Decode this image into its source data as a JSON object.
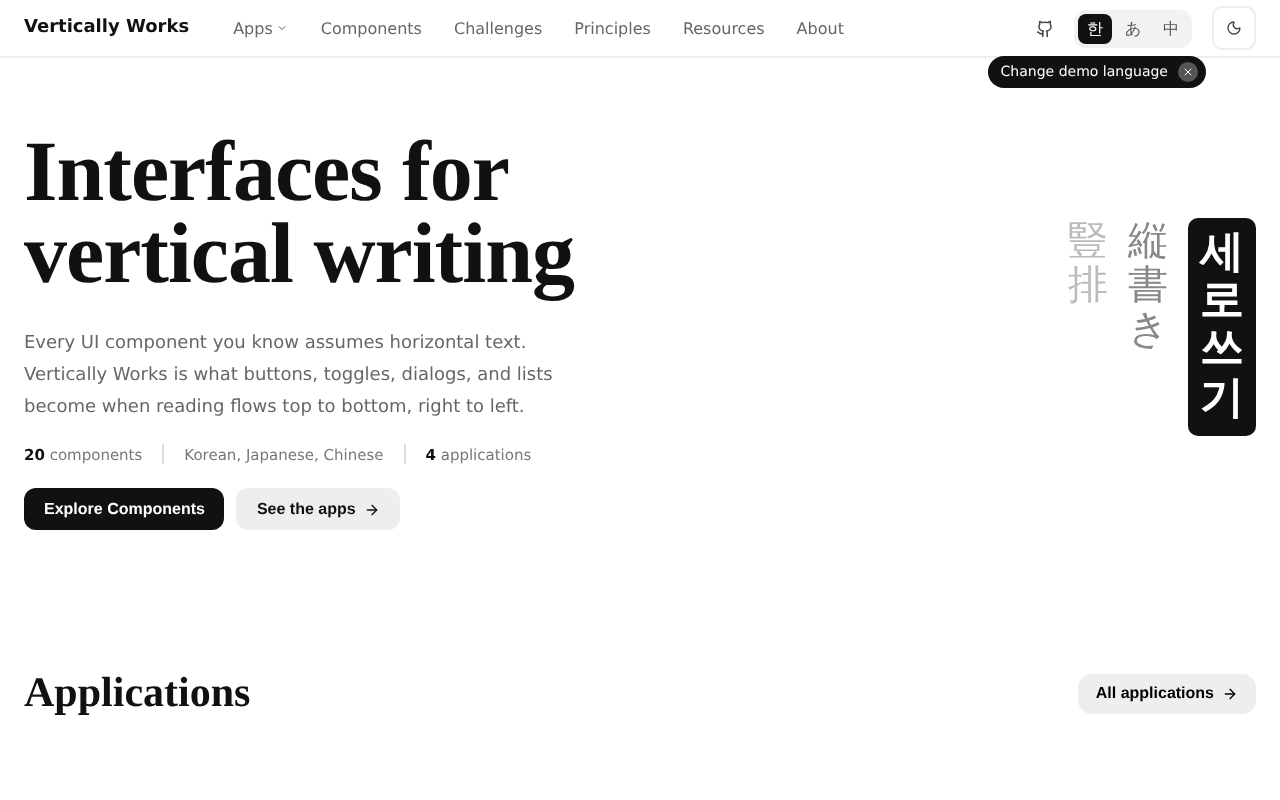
{
  "brand": "Vertically Works",
  "nav": [
    {
      "label": "Apps",
      "dropdown": true
    },
    {
      "label": "Components",
      "dropdown": false
    },
    {
      "label": "Challenges",
      "dropdown": false
    },
    {
      "label": "Principles",
      "dropdown": false
    },
    {
      "label": "Resources",
      "dropdown": false
    },
    {
      "label": "About",
      "dropdown": false
    }
  ],
  "languages": [
    {
      "label": "한",
      "selected": true
    },
    {
      "label": "あ",
      "selected": false
    },
    {
      "label": "中",
      "selected": false
    }
  ],
  "tooltip": {
    "text": "Change demo language"
  },
  "hero": {
    "title_lines": [
      "Interfaces for",
      "vertical writing"
    ],
    "description": "Every UI component you know assumes horizontal text. Vertically Works is what buttons, toggles, dialogs, and lists become when reading flows top to bottom, right to left.",
    "stats": [
      "**20** components",
      "Korean, Japanese, Chinese",
      "**4** applications"
    ],
    "buttons": [
      {
        "label": "Explore Components",
        "kind": "primary"
      },
      {
        "label": "See the apps",
        "kind": "secondary"
      }
    ],
    "vertical_samples": [
      {
        "text": "豎排",
        "kind": "faded"
      },
      {
        "text": "縦書き",
        "kind": "plain"
      },
      {
        "text": "세로쓰기",
        "kind": "boxed"
      }
    ]
  },
  "section": {
    "title": "Applications",
    "link": "All applications"
  }
}
